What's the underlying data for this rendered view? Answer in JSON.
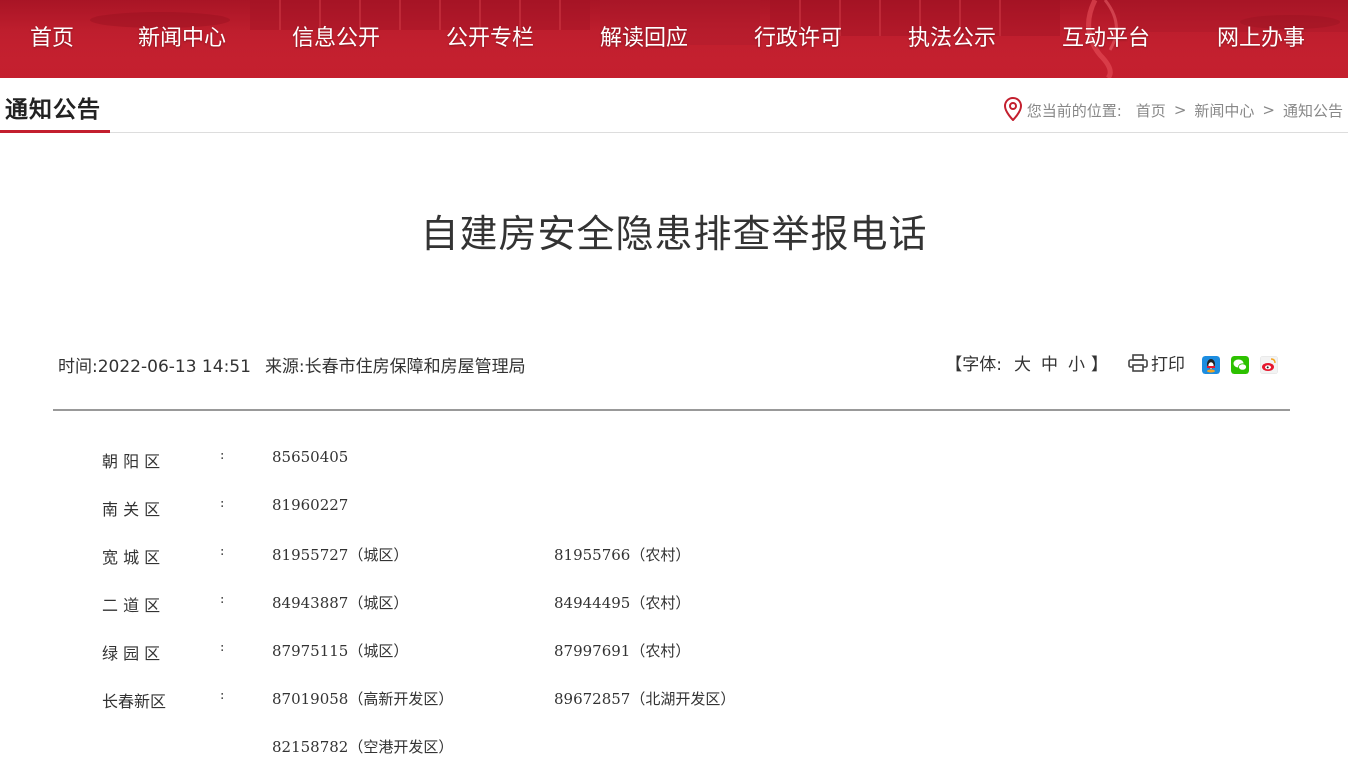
{
  "nav": {
    "items": [
      {
        "label": "首页"
      },
      {
        "label": "新闻中心"
      },
      {
        "label": "信息公开"
      },
      {
        "label": "公开专栏"
      },
      {
        "label": "解读回应"
      },
      {
        "label": "行政许可"
      },
      {
        "label": "执法公示"
      },
      {
        "label": "互动平台"
      },
      {
        "label": "网上办事"
      }
    ]
  },
  "section": {
    "title": "通知公告",
    "breadcrumb": {
      "prefix": "您当前的位置:",
      "items": [
        "首页",
        "新闻中心",
        "通知公告"
      ],
      "separator": ">"
    }
  },
  "article": {
    "title": "自建房安全隐患排查举报电话",
    "time_label": "时间:",
    "time": "2022-06-13 14:51",
    "source_label": "来源:",
    "source": "长春市住房保障和房屋管理局",
    "font_label": "【字体:",
    "font_sizes": [
      "大",
      "中",
      "小"
    ],
    "font_close": "】",
    "print_label": "打印",
    "share_icons": [
      "qq-icon",
      "wechat-icon",
      "weibo-icon"
    ],
    "rows": [
      {
        "label": "朝 阳 区",
        "colon": ":",
        "v1": "85650405",
        "v2": ""
      },
      {
        "label": "南 关 区",
        "colon": ":",
        "v1": "81960227",
        "v2": ""
      },
      {
        "label": "宽 城 区",
        "colon": ":",
        "v1": "81955727（城区）",
        "v2": "81955766（农村）"
      },
      {
        "label": "二 道 区",
        "colon": ":",
        "v1": "84943887（城区）",
        "v2": "84944495（农村）"
      },
      {
        "label": "绿 园 区",
        "colon": ":",
        "v1": "87975115（城区）",
        "v2": "87997691（农村）"
      },
      {
        "label": "长春新区",
        "colon": ":",
        "v1": "87019058（高新开发区）",
        "v2": "89672857（北湖开发区）"
      },
      {
        "label": "",
        "colon": "",
        "v1": "82158782（空港开发区）",
        "v2": ""
      }
    ]
  },
  "colors": {
    "brand_red": "#c31f2e",
    "qq": "#1d8de0",
    "wechat": "#2dc100",
    "weibo": "#e6162d"
  }
}
